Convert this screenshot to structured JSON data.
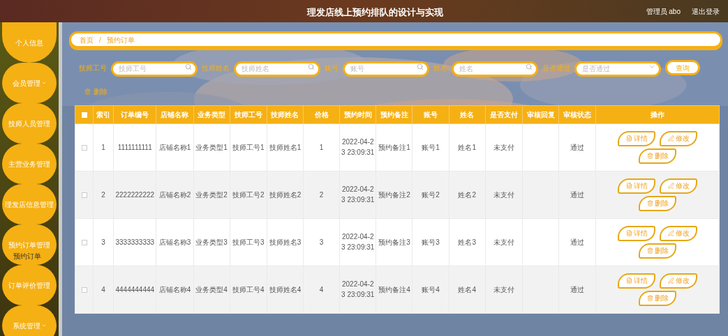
{
  "header": {
    "title": "理发店线上预约排队的设计与实现",
    "user": "管理员 abo",
    "logout": "退出登录"
  },
  "sidebar": {
    "items": [
      {
        "label": "个人信息",
        "kind": "link"
      },
      {
        "label": "会员管理",
        "kind": "group"
      },
      {
        "label": "技师人员管理",
        "kind": "link"
      },
      {
        "label": "主营业务管理",
        "kind": "link"
      },
      {
        "label": "理发店信息管理",
        "kind": "link"
      },
      {
        "label": "预约订单管理",
        "kind": "link",
        "flyout": "预约订单"
      },
      {
        "label": "订单评价管理",
        "kind": "link"
      },
      {
        "label": "系统管理",
        "kind": "group"
      }
    ]
  },
  "breadcrumb": {
    "items": [
      "首页",
      "预约订单"
    ],
    "separator": "/"
  },
  "filters": [
    {
      "label": "技师工号",
      "placeholder": "技师工号",
      "kind": "search"
    },
    {
      "label": "技师姓名",
      "placeholder": "技师姓名",
      "kind": "search"
    },
    {
      "label": "账号",
      "placeholder": "账号",
      "kind": "search"
    },
    {
      "label": "姓名",
      "placeholder": "姓名",
      "kind": "search"
    },
    {
      "label": "是否通过",
      "placeholder": "是否通过",
      "kind": "select"
    }
  ],
  "search_button": "查询",
  "delete_button": "删除",
  "table": {
    "all_selected": false,
    "columns": [
      "索引",
      "订单编号",
      "店铺名称",
      "业务类型",
      "技师工号",
      "技师姓名",
      "价格",
      "预约时间",
      "预约备注",
      "账号",
      "姓名",
      "是否支付",
      "审核回复",
      "审核状态",
      "操作"
    ],
    "rows": [
      {
        "selected": false,
        "cells": [
          "1",
          "1111111111",
          "店铺名称1",
          "业务类型1",
          "技师工号1",
          "技师姓名1",
          "1",
          "2022-04-23 23:09:31",
          "预约备注1",
          "账号1",
          "姓名1",
          "未支付",
          "",
          "通过"
        ],
        "actions": [
          "详情",
          "修改",
          "删除"
        ]
      },
      {
        "selected": false,
        "cells": [
          "2",
          "2222222222",
          "店铺名称2",
          "业务类型2",
          "技师工号2",
          "技师姓名2",
          "2",
          "2022-04-23 23:09:31",
          "预约备注2",
          "账号2",
          "姓名2",
          "未支付",
          "",
          "通过"
        ],
        "actions": [
          "详情",
          "修改",
          "删除"
        ]
      },
      {
        "selected": false,
        "cells": [
          "3",
          "3333333333",
          "店铺名称3",
          "业务类型3",
          "技师工号3",
          "技师姓名3",
          "3",
          "2022-04-23 23:09:31",
          "预约备注3",
          "账号3",
          "姓名3",
          "未支付",
          "",
          "通过"
        ],
        "actions": [
          "详情",
          "修改",
          "删除"
        ]
      },
      {
        "selected": false,
        "cells": [
          "4",
          "4444444444",
          "店铺名称4",
          "业务类型4",
          "技师工号4",
          "技师姓名4",
          "4",
          "2022-04-23 23:09:31",
          "预约备注4",
          "账号4",
          "姓名4",
          "未支付",
          "",
          "通过"
        ],
        "actions": [
          "详情",
          "修改",
          "删除"
        ]
      }
    ]
  }
}
